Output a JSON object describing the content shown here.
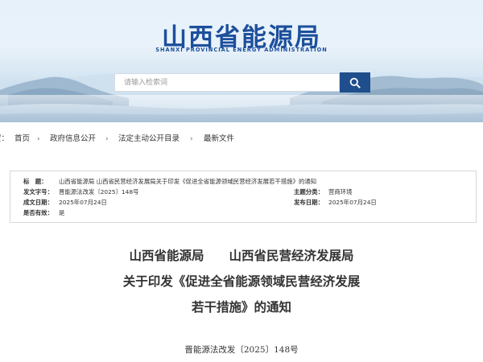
{
  "header": {
    "title": "山西省能源局",
    "subtitle": "SHANXI PROVINCIAL ENERGY ADMINISTRATION",
    "search_placeholder": "请输入检索词",
    "search_icon": "search-icon"
  },
  "breadcrumb": {
    "prefix": "置：",
    "items": [
      "首页",
      "政府信息公开",
      "法定主动公开目录",
      "最新文件"
    ],
    "separator": "›"
  },
  "info": {
    "title_label": "标　题：",
    "title_value": "山西省能源局 山西省民营经济发展局关于印发《促进全省能源领域民营经济发展若干措施》的通知",
    "docno_label": "发文字号：",
    "docno_value": "晋能源法改发〔2025〕148号",
    "topic_label": "主题分类：",
    "topic_value": "营商环境",
    "made_label": "成文日期：",
    "made_value": "2025年07月24日",
    "pub_label": "发布日期：",
    "pub_value": "2025年07月24日",
    "valid_label": "是否有效：",
    "valid_value": "是"
  },
  "article": {
    "title_line1": "山西省能源局　　山西省民营经济发展局",
    "title_line2": "关于印发《促进全省能源领域民营经济发展",
    "title_line3": "若干措施》的通知",
    "doc_number": "晋能源法改发〔2025〕148号"
  },
  "colors": {
    "brand_blue": "#1c4f9c",
    "search_button": "#1f4e8c"
  }
}
